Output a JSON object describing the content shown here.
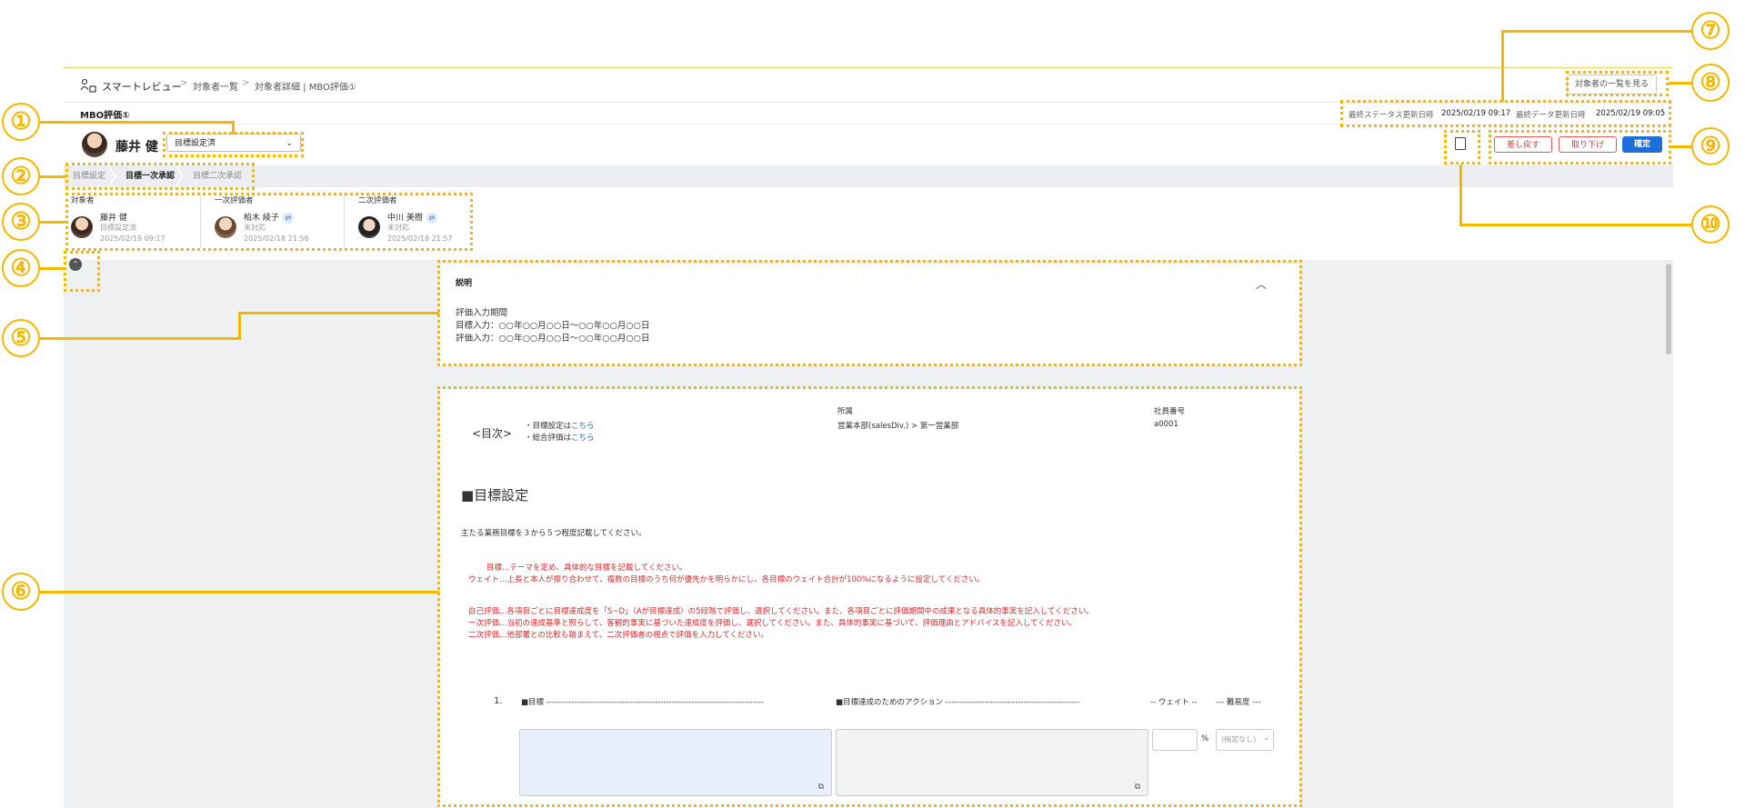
{
  "breadcrumb": {
    "app": "スマートレビュー",
    "items": [
      "対象者一覧",
      "対象者詳細 | MBO評価①"
    ],
    "separator": ">"
  },
  "header": {
    "view_list_button": "対象者の一覧を見る"
  },
  "subheader": {
    "title": "MBO評価①",
    "status_updated_label": "最終ステータス更新日時",
    "status_updated_value": "2025/02/19 09:17",
    "data_updated_label": "最終データ更新日時",
    "data_updated_value": "2025/02/19 09:05"
  },
  "user": {
    "name": "藤井 健",
    "status_select": "目標設定済"
  },
  "actions": {
    "return_label": "差し戻す",
    "withdraw_label": "取り下げ",
    "confirm_label": "確定"
  },
  "steps": [
    "目標設定",
    "目標一次承認",
    "目標二次承認"
  ],
  "active_step": 1,
  "evaluators": [
    {
      "role": "対象者",
      "name": "藤井 健",
      "status": "目標設定済",
      "timestamp": "2025/02/19 09:17"
    },
    {
      "role": "一次評価者",
      "name": "柏木 綾子",
      "status": "未対応",
      "timestamp": "2025/02/18 21:56"
    },
    {
      "role": "二次評価者",
      "name": "中川 美樹",
      "status": "未対応",
      "timestamp": "2025/02/18 21:57"
    }
  ],
  "description": {
    "title": "説明",
    "lines": [
      "評価入力期間",
      "目標入力：○○年○○月○○日～○○年○○月○○日",
      "評価入力：○○年○○月○○日～○○年○○月○○日"
    ]
  },
  "document": {
    "toc_label": "<目次>",
    "toc_line1_prefix": "・目標設定は",
    "toc_line2_prefix": "・総合評価は",
    "toc_link": "こちら",
    "dept_label": "所属",
    "dept_value": "営業本部(salesDiv.) > 第一営業部",
    "emp_label": "社員番号",
    "emp_value": "a0001",
    "section_title": "■目標設定",
    "intro": "主たる業務目標を３から５つ程度記載してください。",
    "red_lines": [
      "目標…テーマを定め、具体的な目標を記載してください。",
      "ウェイト…上長と本人が擦り合わせて、複数の目標のうち何が優先かを明らかにし、各目標のウェイト合計が100%になるように設定してください。",
      "自己評価…各項目ごとに目標達成度を「S~D」（Aが目標達成）の5段階で評価し、選択してください。また、各項目ごとに評価期間中の成果となる具体的事実を記入してください。",
      "一次評価…当初の達成基準と照らして、客観的事実に基づいた達成度を評価し、選択してください。また、具体的事実に基づいて、評価理由とアドバイスを記入してください。",
      "二次評価…他部署との比較も踏まえて、二次評価者の視点で評価を入力してください。"
    ],
    "row_number": "1.",
    "col_goal": "■目標 ------------------------------------------------------------------------------",
    "col_action": "■目標達成のためのアクション ------------------------------------------------",
    "col_weight": "-- ウェイト --",
    "col_difficulty": "--- 難易度 ---",
    "percent": "%",
    "difficulty_placeholder": "(指定なし)"
  },
  "annotations": [
    "①",
    "②",
    "③",
    "④",
    "⑤",
    "⑥",
    "⑦",
    "⑧",
    "⑨",
    "⑩"
  ],
  "colors": {
    "annotation": "#f5b800",
    "primary": "#1e6fd9",
    "danger": "#d93a3a"
  }
}
